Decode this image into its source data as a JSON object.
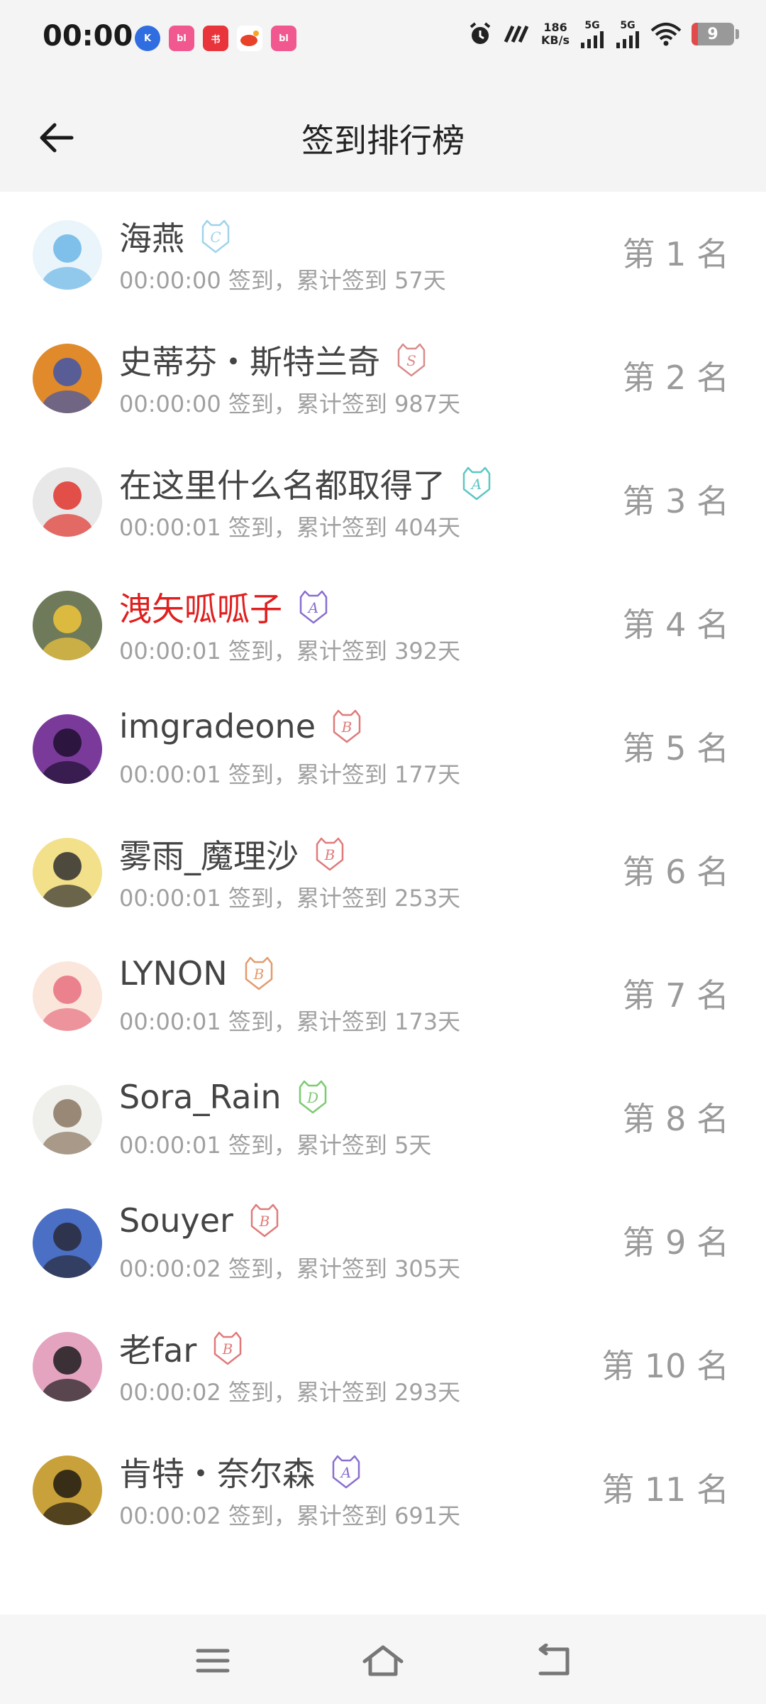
{
  "status_bar": {
    "time": "00:00",
    "net_speed_value": "186",
    "net_speed_unit": "KB/s",
    "signal_1_label": "5G",
    "signal_2_label": "5G",
    "battery_level": "9",
    "notification_icons": [
      "k-app-icon",
      "bilibili-icon",
      "xiaohongshu-icon",
      "weibo-icon",
      "bilibili-icon"
    ]
  },
  "header": {
    "title": "签到排行榜"
  },
  "ranking": [
    {
      "name": "海燕",
      "badge": "C",
      "badge_color": "#9fd3ea",
      "sub": "00:00:00 签到，累计签到 57天",
      "rank": "第 1 名",
      "highlight": false,
      "avatar_colors": [
        "#eaf5fb",
        "#6bb6e6"
      ]
    },
    {
      "name": "史蒂芬・斯特兰奇",
      "badge": "S",
      "badge_color": "#d98c8c",
      "sub": "00:00:00 签到，累计签到 987天",
      "rank": "第 2 名",
      "highlight": false,
      "avatar_colors": [
        "#e08a2c",
        "#4056a8"
      ]
    },
    {
      "name": "在这里什么名都取得了",
      "badge": "A",
      "badge_color": "#5cc7c4",
      "sub": "00:00:01 签到，累计签到 404天",
      "rank": "第 3 名",
      "highlight": false,
      "avatar_colors": [
        "#e8e8e8",
        "#e0332c"
      ]
    },
    {
      "name": "洩矢呱呱子",
      "badge": "A",
      "badge_color": "#8a6fcf",
      "sub": "00:00:01 签到，累计签到 392天",
      "rank": "第 4 名",
      "highlight": true,
      "avatar_colors": [
        "#6f7a5a",
        "#f0c63c"
      ]
    },
    {
      "name": "imgradeone",
      "badge": "B",
      "badge_color": "#e07a7a",
      "sub": "00:00:01 签到，累计签到 177天",
      "rank": "第 5 名",
      "highlight": false,
      "avatar_colors": [
        "#7a3a9a",
        "#1e1030"
      ]
    },
    {
      "name": "雾雨_魔理沙",
      "badge": "B",
      "badge_color": "#e07a7a",
      "sub": "00:00:01 签到，累计签到 253天",
      "rank": "第 6 名",
      "highlight": false,
      "avatar_colors": [
        "#f3e08a",
        "#2f2f2f"
      ]
    },
    {
      "name": "LYNON",
      "badge": "B",
      "badge_color": "#e39a6e",
      "sub": "00:00:01 签到，累计签到 173天",
      "rank": "第 7 名",
      "highlight": false,
      "avatar_colors": [
        "#fbe6dc",
        "#e76f7f"
      ]
    },
    {
      "name": "Sora_Rain",
      "badge": "D",
      "badge_color": "#7ccb6f",
      "sub": "00:00:01 签到，累计签到 5天",
      "rank": "第 8 名",
      "highlight": false,
      "avatar_colors": [
        "#efefec",
        "#8a7560"
      ]
    },
    {
      "name": "Souyer",
      "badge": "B",
      "badge_color": "#e07a7a",
      "sub": "00:00:02 签到，累计签到 305天",
      "rank": "第 9 名",
      "highlight": false,
      "avatar_colors": [
        "#4a6fc4",
        "#2a2a3a"
      ]
    },
    {
      "name": "老far",
      "badge": "B",
      "badge_color": "#e07a7a",
      "sub": "00:00:02 签到，累计签到 293天",
      "rank": "第 10 名",
      "highlight": false,
      "avatar_colors": [
        "#e4a3bf",
        "#1c1c1c"
      ]
    },
    {
      "name": "肯特・奈尔森",
      "badge": "A",
      "badge_color": "#8a6fcf",
      "sub": "00:00:02 签到，累计签到 691天",
      "rank": "第 11 名",
      "highlight": false,
      "avatar_colors": [
        "#c9a13a",
        "#1f1a12"
      ]
    }
  ],
  "nav_bar": {
    "icons": [
      "menu-icon",
      "home-icon",
      "back-nav-icon"
    ]
  }
}
